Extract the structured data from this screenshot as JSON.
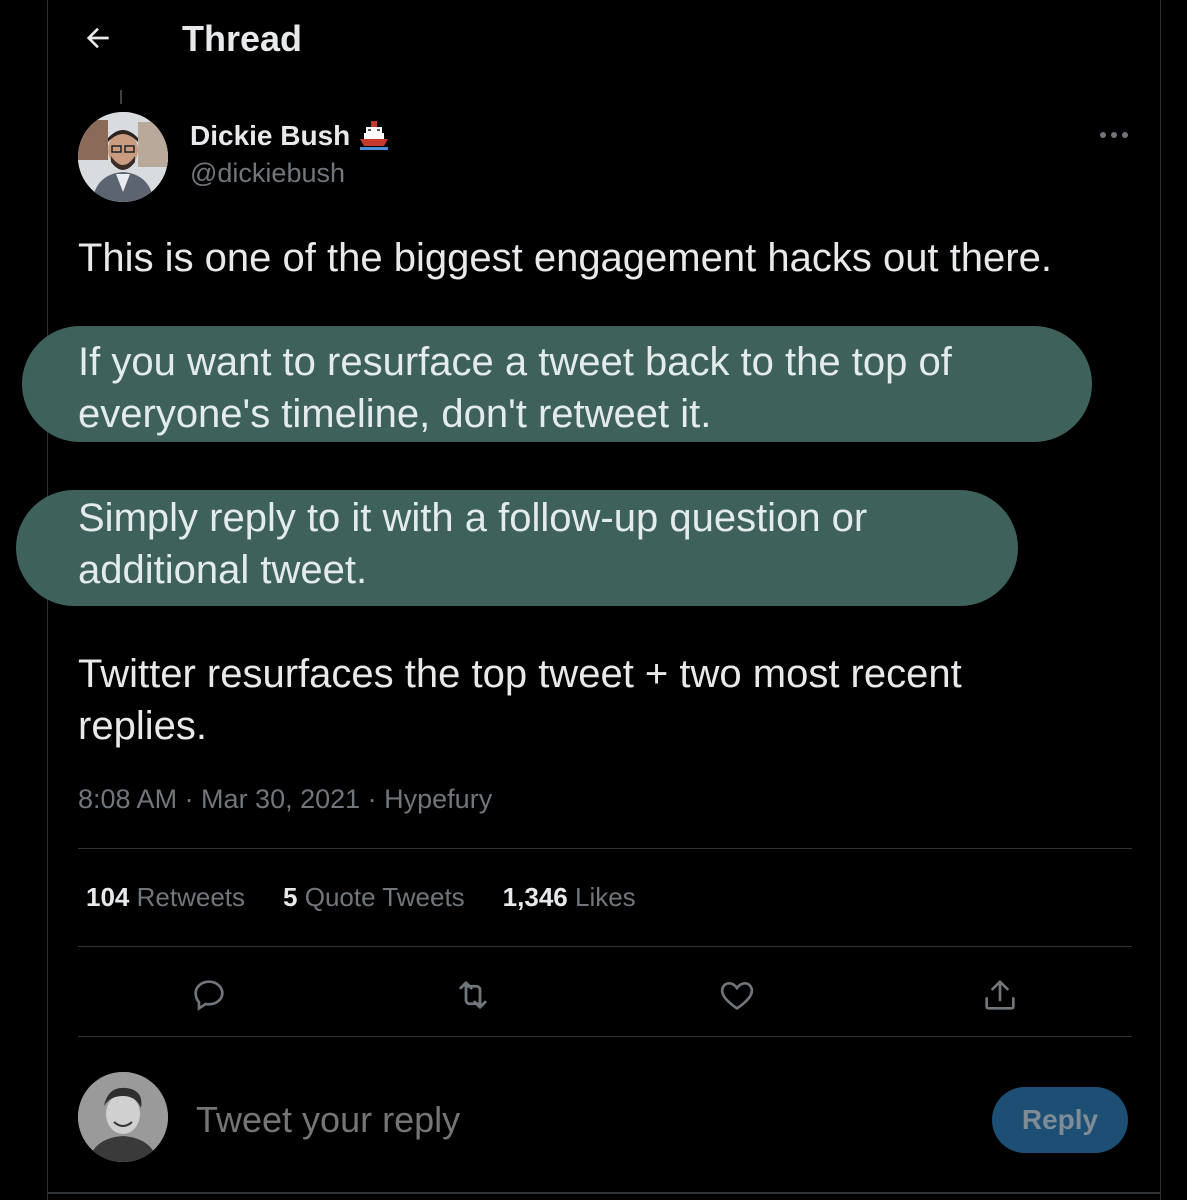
{
  "header": {
    "title": "Thread"
  },
  "tweet": {
    "author_name": "Dickie Bush",
    "author_handle": "@dickiebush",
    "paragraphs": [
      "This is one of the biggest engagement hacks out there.",
      "If you want to resurface a tweet back to the top of everyone's timeline, don't retweet it.",
      "Simply reply to it with a follow-up question or additional tweet.",
      "Twitter resurfaces the top tweet + two most recent replies."
    ],
    "meta": "8:08 AM · Mar 30, 2021 · Hypefury",
    "highlight_color": "#3f615c"
  },
  "stats": {
    "retweets_count": "104",
    "retweets_label": "Retweets",
    "quotes_count": "5",
    "quotes_label": "Quote Tweets",
    "likes_count": "1,346",
    "likes_label": "Likes"
  },
  "actions": [
    "reply-icon",
    "retweet-icon",
    "like-icon",
    "share-icon"
  ],
  "composer": {
    "placeholder": "Tweet your reply",
    "button_label": "Reply",
    "button_color": "#1d4f75"
  }
}
